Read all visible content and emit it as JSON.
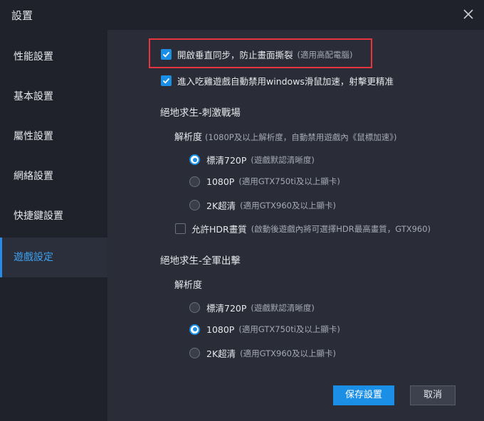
{
  "window": {
    "title": "設置",
    "close_icon": "close-icon"
  },
  "sidebar": {
    "items": [
      {
        "label": "性能設置"
      },
      {
        "label": "基本設置"
      },
      {
        "label": "屬性設置"
      },
      {
        "label": "網絡設置"
      },
      {
        "label": "快捷鍵設置"
      },
      {
        "label": "遊戲設定",
        "active": true
      }
    ]
  },
  "options": {
    "vsync": {
      "label": "開啟垂直同步，防止畫面撕裂",
      "hint": "(適用高配電腦)",
      "checked": true
    },
    "disable_mouse_accel": {
      "label": "進入吃雞遊戲自動禁用windows滑鼠加速，射擊更精准",
      "checked": true
    }
  },
  "game1": {
    "title": "絕地求生-刺激戰場",
    "resolution_label": "解析度",
    "resolution_hint": "(1080P及以上解析度，自動禁用遊戲內《鼠標加速》)",
    "options": [
      {
        "label": "標清720P",
        "hint": "(遊戲默認清晰度)",
        "selected": true
      },
      {
        "label": "1080P",
        "hint": "(適用GTX750ti及以上顯卡)",
        "selected": false
      },
      {
        "label": "2K超清",
        "hint": "(適用GTX960及以上顯卡)",
        "selected": false
      }
    ],
    "hdr": {
      "label": "允許HDR畫質",
      "hint": "(啟動後遊戲內將可選擇HDR最高畫質，GTX960)",
      "checked": false
    }
  },
  "game2": {
    "title": "絕地求生-全軍出擊",
    "resolution_label": "解析度",
    "options": [
      {
        "label": "標清720P",
        "hint": "(遊戲默認清晰度)",
        "selected": false
      },
      {
        "label": "1080P",
        "hint": "(適用GTX750ti及以上顯卡)",
        "selected": true
      },
      {
        "label": "2K超清",
        "hint": "(適用GTX960及以上顯卡)",
        "selected": false
      }
    ]
  },
  "buttons": {
    "save": "保存設置",
    "cancel": "取消"
  },
  "colors": {
    "accent": "#1b8fe6",
    "highlight": "#e8353d",
    "active_nav": "#3ea2f0"
  }
}
